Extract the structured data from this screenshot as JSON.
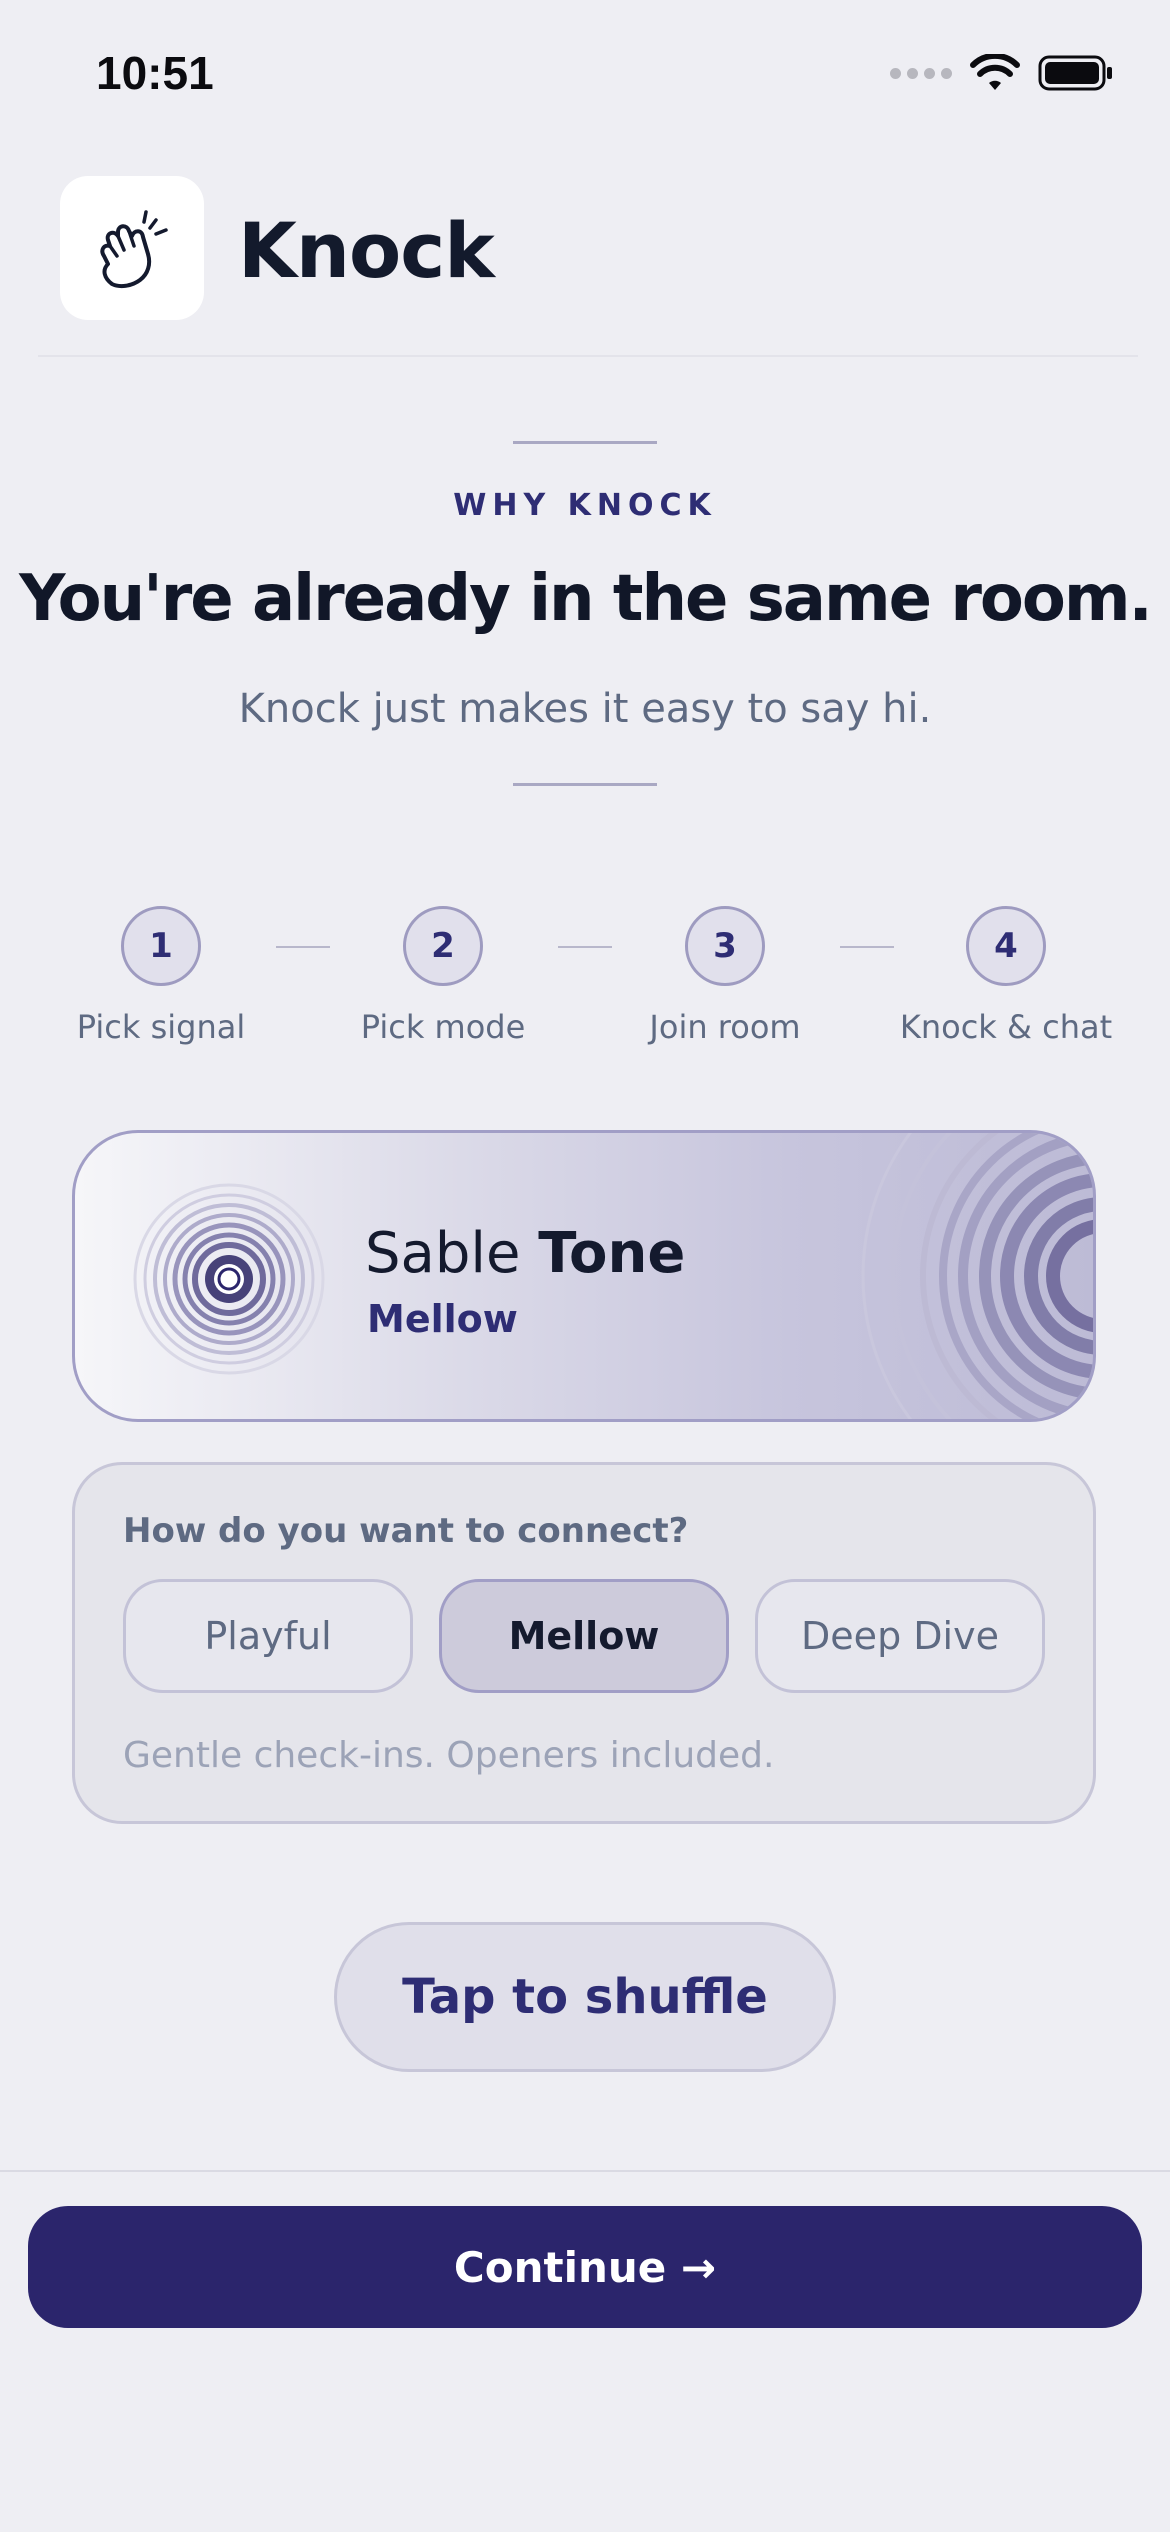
{
  "status_bar": {
    "time": "10:51"
  },
  "header": {
    "app_name": "Knock",
    "icon": "knocking-hand-icon"
  },
  "hero": {
    "eyebrow": "WHY KNOCK",
    "headline": "You're already in the same room.",
    "subline": "Knock just makes it easy to say hi."
  },
  "steps": [
    {
      "number": "1",
      "label": "Pick signal"
    },
    {
      "number": "2",
      "label": "Pick mode"
    },
    {
      "number": "3",
      "label": "Join room"
    },
    {
      "number": "4",
      "label": "Knock & chat"
    }
  ],
  "signal_card": {
    "name_first": "Sable",
    "name_second": "Tone",
    "mode": "Mellow",
    "icon": "ripple-orb-icon"
  },
  "connect": {
    "question": "How do you want to connect?",
    "options": [
      "Playful",
      "Mellow",
      "Deep Dive"
    ],
    "selected": "Mellow",
    "description": "Gentle check-ins. Openers included."
  },
  "shuffle_label": "Tap to shuffle",
  "continue_label": "Continue →",
  "colors": {
    "background": "#EEEEF3",
    "accent": "#2B256C",
    "accent_text": "#2E2D74",
    "muted_text": "#5E6A82"
  }
}
